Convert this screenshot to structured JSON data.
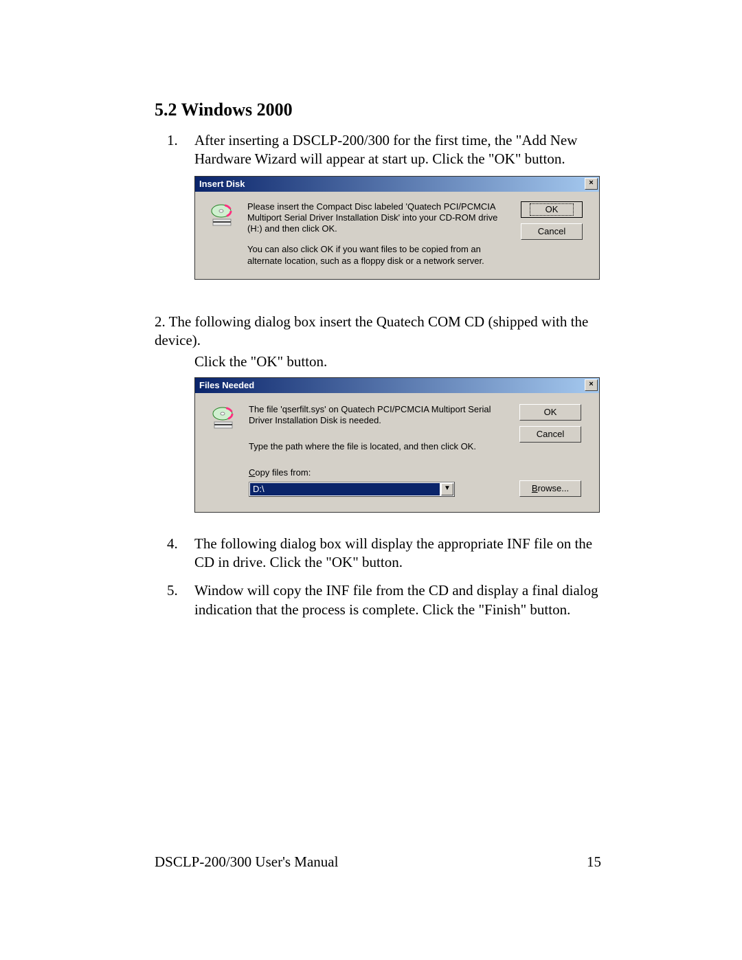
{
  "heading": "5.2   Windows 2000",
  "steps": {
    "s1_num": "1.",
    "s1_body": "After inserting a DSCLP-200/300 for the first time, the \"Add New Hardware Wizard will appear at start up. Click the \"OK\" button.",
    "s2": "2.       The following dialog box insert the Quatech COM CD (shipped with the device).",
    "s3": "Click the \"OK\" button.",
    "s4_num": "4.",
    "s4_body": "The following dialog box will display the appropriate INF file on the CD in drive. Click the \"OK\" button.",
    "s5_num": "5.",
    "s5_body": "Window will copy the INF file from the CD and display a final dialog indication that the process is complete. Click the \"Finish\" button."
  },
  "dialog1": {
    "title": "Insert Disk",
    "p1": "Please insert the Compact Disc labeled 'Quatech PCI/PCMCIA Multiport Serial Driver Installation Disk' into your CD-ROM drive (H:) and then click OK.",
    "p2": "You can also click OK if you want files to be copied from an alternate location, such as a floppy disk or a network server.",
    "ok": "OK",
    "cancel": "Cancel"
  },
  "dialog2": {
    "title": "Files Needed",
    "p1": "The file 'qserfilt.sys' on Quatech PCI/PCMCIA Multiport Serial Driver Installation Disk is needed.",
    "p2": "Type the path where the file is located, and then click OK.",
    "copy_label_pre": "C",
    "copy_label_rest": "opy files from:",
    "combo_value": "D:\\",
    "ok": "OK",
    "cancel": "Cancel",
    "browse_pre": "B",
    "browse_rest": "rowse..."
  },
  "footer": {
    "left": "DSCLP-200/300 User's Manual",
    "right": "15"
  },
  "glyphs": {
    "x": "×",
    "dd": "▼"
  }
}
